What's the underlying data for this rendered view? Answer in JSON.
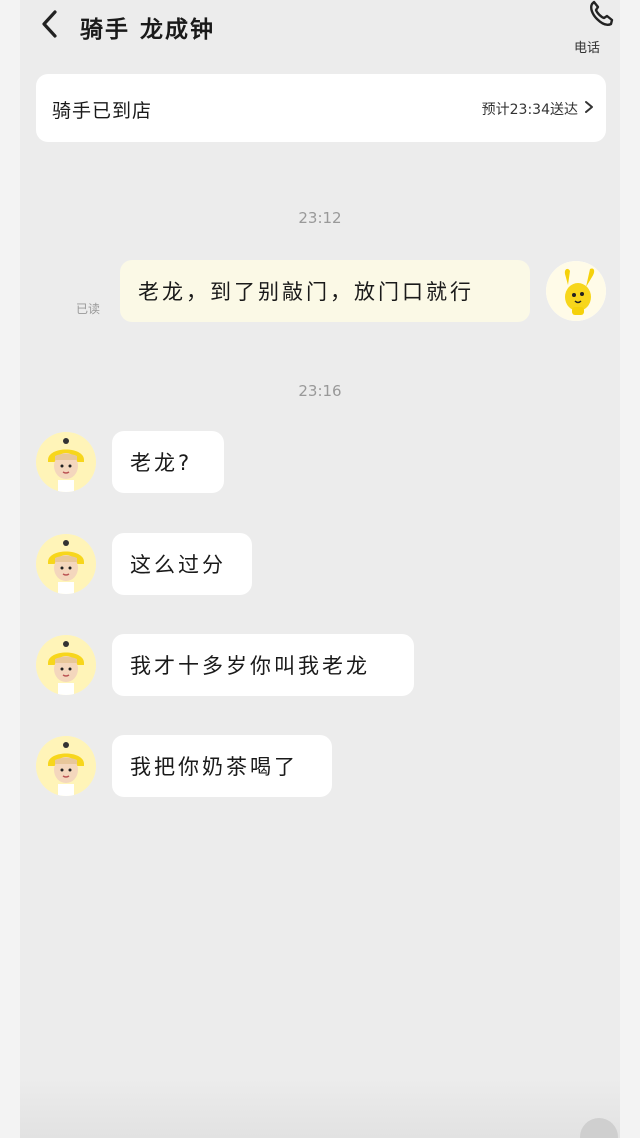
{
  "header": {
    "title": "骑手 龙成钟",
    "call_label": "电话"
  },
  "status": {
    "text": "骑手已到店",
    "eta": "预计23:34送达"
  },
  "messages": [
    {
      "type": "time",
      "text": "23:12"
    },
    {
      "type": "outgoing",
      "text": "老龙，到了别敲门，放门口就行",
      "read": "已读"
    },
    {
      "type": "time",
      "text": "23:16"
    },
    {
      "type": "incoming",
      "text": "老龙?"
    },
    {
      "type": "incoming",
      "text": "这么过分"
    },
    {
      "type": "incoming",
      "text": "我才十多岁你叫我老龙"
    },
    {
      "type": "incoming",
      "text": "我把你奶茶喝了"
    }
  ],
  "colors": {
    "background": "#ececec",
    "outgoing_bubble": "#fbf9e6",
    "incoming_bubble": "#ffffff",
    "avatar_yellow": "#f7d61c"
  },
  "icons": {
    "back": "chevron-left-icon",
    "call": "phone-icon",
    "eta_arrow": "chevron-right-icon"
  }
}
